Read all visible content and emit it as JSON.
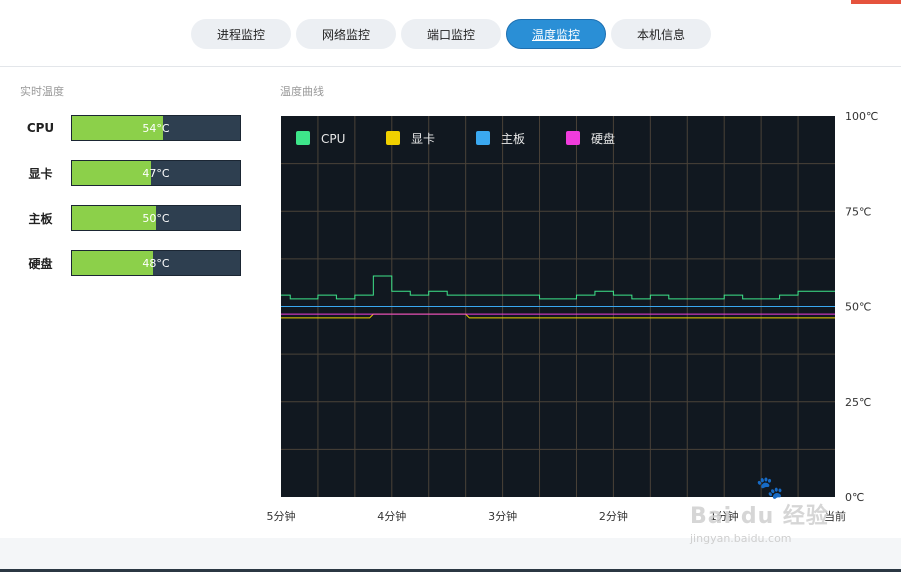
{
  "tabs": [
    {
      "label": "进程监控",
      "active": false
    },
    {
      "label": "网络监控",
      "active": false
    },
    {
      "label": "端口监控",
      "active": false
    },
    {
      "label": "温度监控",
      "active": true
    },
    {
      "label": "本机信息",
      "active": false
    }
  ],
  "realtime": {
    "title": "实时温度",
    "items": [
      {
        "label": "CPU",
        "value_text": "54°C",
        "value": 54
      },
      {
        "label": "显卡",
        "value_text": "47°C",
        "value": 47
      },
      {
        "label": "主板",
        "value_text": "50°C",
        "value": 50
      },
      {
        "label": "硬盘",
        "value_text": "48°C",
        "value": 48
      }
    ]
  },
  "curve": {
    "title": "温度曲线"
  },
  "colors": {
    "accent": "#2a8fd6",
    "bar_fill": "#8cd04a",
    "bar_track": "#2e3f50",
    "chart_bg": "#111820",
    "grid": "#4a4238",
    "cpu": "#3ee58a",
    "gpu": "#f0d000",
    "board": "#3aa8f0",
    "disk": "#f03cdc"
  },
  "chart_data": {
    "type": "line",
    "ylim": [
      0,
      100
    ],
    "yticks": [
      "100℃",
      "75℃",
      "50℃",
      "25℃",
      "0℃"
    ],
    "ytick_values": [
      100,
      75,
      50,
      25,
      0
    ],
    "xticks": [
      "5分钟",
      "4分钟",
      "3分钟",
      "2分钟",
      "1分钟",
      "当前"
    ],
    "xlim": [
      0,
      300
    ],
    "legend_position": "top-left",
    "series": [
      {
        "name": "CPU",
        "color": "#3ee58a",
        "x": [
          0,
          5,
          10,
          20,
          30,
          40,
          50,
          60,
          70,
          80,
          90,
          100,
          110,
          120,
          130,
          140,
          150,
          160,
          170,
          180,
          190,
          200,
          210,
          220,
          230,
          240,
          250,
          260,
          270,
          280,
          290,
          300
        ],
        "y": [
          53,
          52,
          52,
          53,
          52,
          53,
          58,
          54,
          53,
          54,
          53,
          53,
          53,
          53,
          53,
          52,
          52,
          53,
          54,
          53,
          52,
          53,
          52,
          52,
          52,
          53,
          52,
          52,
          53,
          54,
          54,
          54
        ]
      },
      {
        "name": "显卡",
        "color": "#f0d000",
        "x": [
          0,
          48,
          50,
          100,
          102,
          300
        ],
        "y": [
          47,
          47,
          48,
          48,
          47,
          47
        ]
      },
      {
        "name": "主板",
        "color": "#3aa8f0",
        "x": [
          0,
          300
        ],
        "y": [
          50,
          50
        ]
      },
      {
        "name": "硬盘",
        "color": "#f03cdc",
        "x": [
          0,
          300
        ],
        "y": [
          48,
          48
        ]
      }
    ]
  },
  "watermark": {
    "main": "Bai du 经验",
    "sub": "jingyan.baidu.com"
  }
}
